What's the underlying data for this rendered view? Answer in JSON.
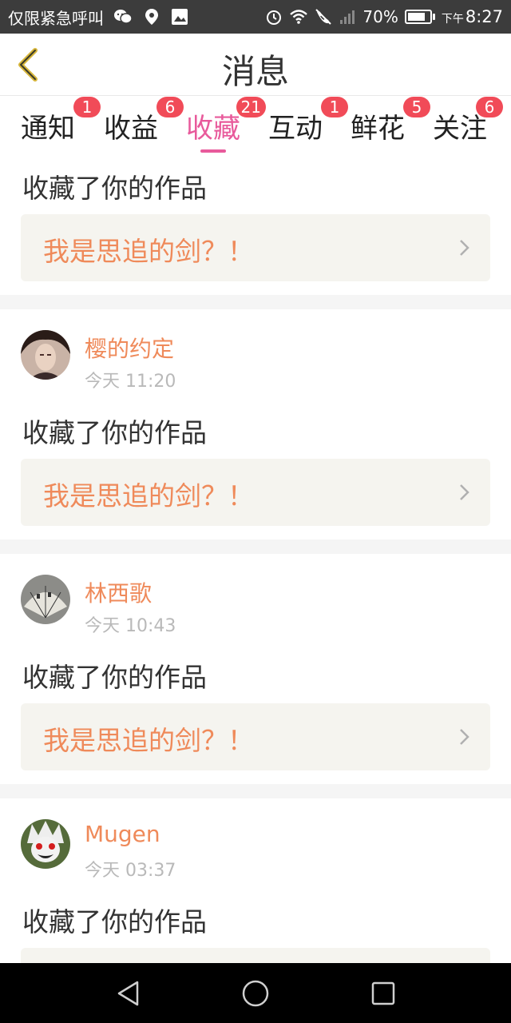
{
  "status_bar": {
    "carrier_text": "仅限紧急呼叫",
    "battery": "70%",
    "time_period": "下午",
    "time": "8:27",
    "icons": [
      "wechat-icon",
      "location-icon",
      "image-icon",
      "alarm-icon",
      "wifi-icon",
      "no-call-icon",
      "signal-icon",
      "battery-icon"
    ]
  },
  "header": {
    "title": "消息",
    "back_icon": "chevron-left-icon"
  },
  "tabs": [
    {
      "label": "通知",
      "badge": "1"
    },
    {
      "label": "收益",
      "badge": "6"
    },
    {
      "label": "收藏",
      "badge": "21",
      "active": true
    },
    {
      "label": "互动",
      "badge": "1"
    },
    {
      "label": "鲜花",
      "badge": "5"
    },
    {
      "label": "关注",
      "badge": "6"
    }
  ],
  "colors": {
    "accent": "#e85a9b",
    "badge": "#f14b58",
    "orange": "#ef8a5a"
  },
  "messages": [
    {
      "user": "",
      "time": "",
      "action": "收藏了你的作品",
      "work_title": "我是思追的剑？！"
    },
    {
      "user": "樱的约定",
      "time": "今天 11:20",
      "action": "收藏了你的作品",
      "work_title": "我是思追的剑？！"
    },
    {
      "user": "林西歌",
      "time": "今天 10:43",
      "action": "收藏了你的作品",
      "work_title": "我是思追的剑？！"
    },
    {
      "user": "Mugen",
      "time": "今天 03:37",
      "action": "收藏了你的作品",
      "work_title": ""
    }
  ],
  "nav": {
    "back_icon": "triangle-back-icon",
    "home_icon": "circle-home-icon",
    "recents_icon": "square-recents-icon"
  }
}
